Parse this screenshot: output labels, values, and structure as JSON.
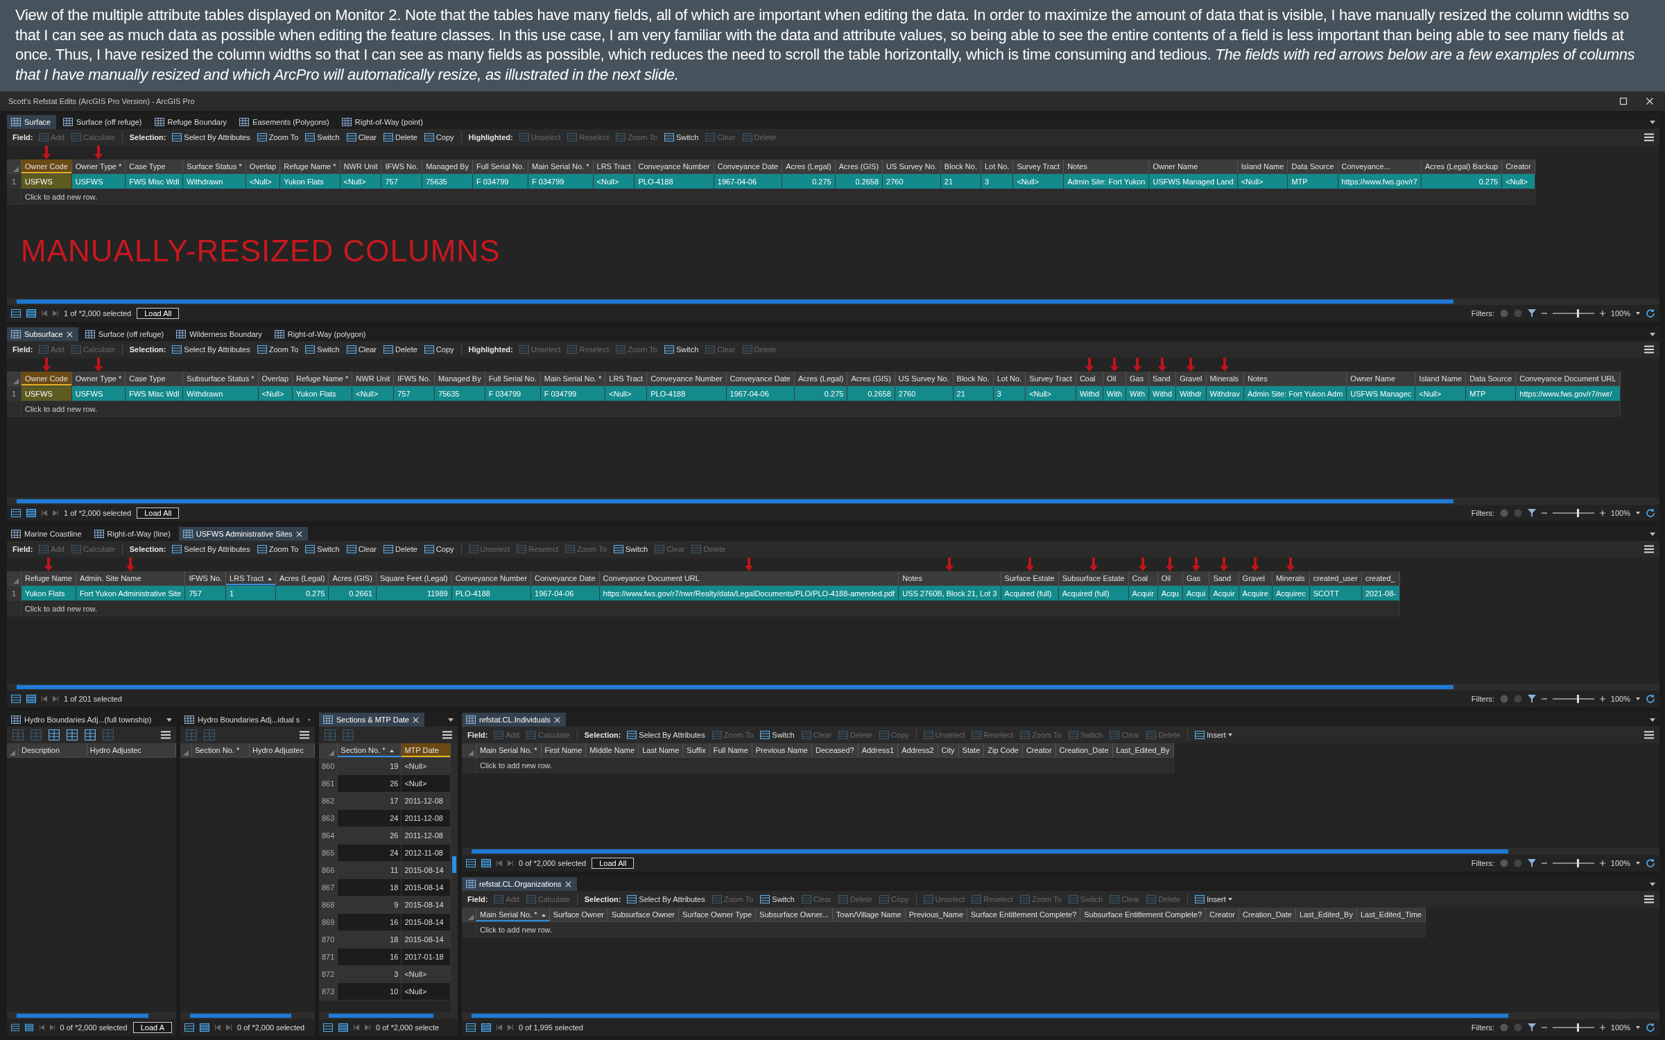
{
  "caption": "View of the multiple attribute tables displayed on Monitor 2. Note that the tables have many fields, all of which are important when editing the data. In order to maximize the amount of data that is visible, I have manually resized the column widths so that I can see as much data as possible when editing the feature classes. In this use case, I am very familiar with the data and attribute values, so being able to see the entire contents of a field is less important than being able to see many fields at once. Thus, I have resized the column widths so that I can see as many fields as possible, which reduces the need to scroll the table horizontally, which is time consuming and tedious. *The fields with red arrows below are a few examples of columns that I have manually resized and which ArcPro will automatically resize, as illustrated in the next slide.*",
  "window": {
    "title": "Scott's Refstat Edits (ArcGIS Pro Version) - ArcGIS Pro"
  },
  "panes": [
    {
      "tabs": [
        {
          "label": "Surface",
          "selected": true,
          "closable": false
        },
        {
          "label": "Surface (off refuge)",
          "selected": false,
          "closable": false
        },
        {
          "label": "Refuge Boundary",
          "selected": false,
          "closable": false
        },
        {
          "label": "Easements (Polygons)",
          "selected": false,
          "closable": false
        },
        {
          "label": "Right-of-Way (point)",
          "selected": false,
          "closable": false
        }
      ],
      "toolbar": {
        "kind": "full",
        "groups": [
          {
            "label": "Field:",
            "items": [
              {
                "label": "Add",
                "disabled": true
              },
              {
                "label": "Calculate",
                "disabled": true
              }
            ]
          },
          {
            "label": "Selection:",
            "items": [
              {
                "label": "Select By Attributes",
                "disabled": false
              },
              {
                "label": "Zoom To",
                "disabled": false
              },
              {
                "label": "Switch",
                "disabled": false
              },
              {
                "label": "Clear",
                "disabled": false
              },
              {
                "label": "Delete",
                "disabled": false
              },
              {
                "label": "Copy",
                "disabled": false
              }
            ]
          },
          {
            "label": "Highlighted:",
            "items": [
              {
                "label": "Unselect",
                "disabled": true
              },
              {
                "label": "Reselect",
                "disabled": true
              },
              {
                "label": "Zoom To",
                "disabled": true
              },
              {
                "label": "Switch",
                "disabled": false
              },
              {
                "label": "Clear",
                "disabled": true
              },
              {
                "label": "Delete",
                "disabled": true
              }
            ]
          }
        ]
      },
      "table": {
        "columns": [
          {
            "label": "Owner Code",
            "highlighted": true,
            "marked": true
          },
          {
            "label": "Owner Type *",
            "marked": true
          },
          {
            "label": "Case Type"
          },
          {
            "label": "Surface Status *"
          },
          {
            "label": "Overlap"
          },
          {
            "label": "Refuge Name *"
          },
          {
            "label": "NWR Unit"
          },
          {
            "label": "IFWS No."
          },
          {
            "label": "Managed By"
          },
          {
            "label": "Full Serial No."
          },
          {
            "label": "Main Serial No. *"
          },
          {
            "label": "LRS Tract"
          },
          {
            "label": "Conveyance Number"
          },
          {
            "label": "Conveyance Date"
          },
          {
            "label": "Acres (Legal)",
            "numeric": true
          },
          {
            "label": "Acres (GIS)",
            "numeric": true
          },
          {
            "label": "US Survey No."
          },
          {
            "label": "Block No."
          },
          {
            "label": "Lot No."
          },
          {
            "label": "Survey Tract"
          },
          {
            "label": "Notes"
          },
          {
            "label": "Owner Name"
          },
          {
            "label": "Island Name"
          },
          {
            "label": "Data Source"
          },
          {
            "label": "Conveyance..."
          },
          {
            "label": "Acres (Legal) Backup",
            "numeric": true
          },
          {
            "label": "Creator"
          }
        ],
        "rows": [
          {
            "number": "1",
            "selected": true,
            "cells": [
              "USFWS",
              "USFWS",
              "FWS Misc Wdl",
              "Withdrawn",
              "<Null>",
              "Yukon Flats",
              "<Null>",
              "757",
              "75635",
              "F 034799",
              "F 034799",
              "<Null>",
              "PLO-4188",
              "1967-04-06",
              "0.275",
              "0.2658",
              "2760",
              "21",
              "3",
              "<Null>",
              "Admin Site: Fort Yukon",
              "USFWS Managed Land",
              "<Null>",
              "MTP",
              "https://www.fws.gov/r7",
              "0.275",
              "<Null>"
            ]
          }
        ],
        "add_row": "Click to add new row."
      },
      "annotation": "MANUALLY-RESIZED COLUMNS",
      "footer": {
        "selection": "1 of *2,000 selected",
        "load_button": "Load All",
        "filters_label": "Filters:",
        "zoom": {
          "level": 0.62,
          "reading": "100%"
        }
      }
    },
    {
      "tabs": [
        {
          "label": "Subsurface",
          "selected": true,
          "closable": true
        },
        {
          "label": "Surface (off refuge)",
          "selected": false,
          "closable": false
        },
        {
          "label": "Wilderness Boundary",
          "selected": false,
          "closable": false
        },
        {
          "label": "Right-of-Way (polygon)",
          "selected": false,
          "closable": false
        }
      ],
      "toolbar": {
        "kind": "full",
        "groups": [
          {
            "label": "Field:",
            "items": [
              {
                "label": "Add",
                "disabled": true
              },
              {
                "label": "Calculate",
                "disabled": true
              }
            ]
          },
          {
            "label": "Selection:",
            "items": [
              {
                "label": "Select By Attributes",
                "disabled": false
              },
              {
                "label": "Zoom To",
                "disabled": false
              },
              {
                "label": "Switch",
                "disabled": false
              },
              {
                "label": "Clear",
                "disabled": false
              },
              {
                "label": "Delete",
                "disabled": false
              },
              {
                "label": "Copy",
                "disabled": false
              }
            ]
          },
          {
            "label": "Highlighted:",
            "items": [
              {
                "label": "Unselect",
                "disabled": true
              },
              {
                "label": "Reselect",
                "disabled": true
              },
              {
                "label": "Zoom To",
                "disabled": true
              },
              {
                "label": "Switch",
                "disabled": false
              },
              {
                "label": "Clear",
                "disabled": true
              },
              {
                "label": "Delete",
                "disabled": true
              }
            ]
          }
        ]
      },
      "table": {
        "columns": [
          {
            "label": "Owner Code",
            "highlighted": true,
            "marked": true
          },
          {
            "label": "Owner Type *",
            "marked": true
          },
          {
            "label": "Case Type"
          },
          {
            "label": "Subsurface Status *"
          },
          {
            "label": "Overlap"
          },
          {
            "label": "Refuge Name *"
          },
          {
            "label": "NWR Unit"
          },
          {
            "label": "IFWS No."
          },
          {
            "label": "Managed By"
          },
          {
            "label": "Full Serial No."
          },
          {
            "label": "Main Serial No. *"
          },
          {
            "label": "LRS Tract"
          },
          {
            "label": "Conveyance Number"
          },
          {
            "label": "Conveyance Date"
          },
          {
            "label": "Acres (Legal)",
            "numeric": true
          },
          {
            "label": "Acres (GIS)",
            "numeric": true
          },
          {
            "label": "US Survey No."
          },
          {
            "label": "Block No."
          },
          {
            "label": "Lot No."
          },
          {
            "label": "Survey Tract"
          },
          {
            "label": "Coal",
            "marked": true
          },
          {
            "label": "Oil",
            "marked": true
          },
          {
            "label": "Gas",
            "marked": true
          },
          {
            "label": "Sand",
            "marked": true
          },
          {
            "label": "Gravel",
            "marked": true
          },
          {
            "label": "Minerals",
            "marked": true
          },
          {
            "label": "Notes"
          },
          {
            "label": "Owner Name"
          },
          {
            "label": "Island Name"
          },
          {
            "label": "Data Source"
          },
          {
            "label": "Conveyance Document URL"
          }
        ],
        "rows": [
          {
            "number": "1",
            "selected": true,
            "cells": [
              "USFWS",
              "USFWS",
              "FWS Misc Wdl",
              "Withdrawn",
              "<Null>",
              "Yukon Flats",
              "<Null>",
              "757",
              "75635",
              "F 034799",
              "F 034799",
              "<Null>",
              "PLO-4188",
              "1967-04-06",
              "0.275",
              "0.2658",
              "2760",
              "21",
              "3",
              "<Null>",
              "Withd",
              "With",
              "With",
              "Withd",
              "Withdr",
              "Withdrav",
              "Admin Site: Fort Yukon Adm",
              "USFWS Managec",
              "<Null>",
              "MTP",
              "https://www.fws.gov/r7/nwr/"
            ]
          }
        ],
        "add_row": "Click to add new row."
      },
      "footer": {
        "selection": "1 of *2,000 selected",
        "load_button": "Load All",
        "filters_label": "Filters:",
        "zoom": {
          "level": 0.62,
          "reading": "100%"
        }
      }
    },
    {
      "tabs": [
        {
          "label": "Marine Coastline",
          "selected": false,
          "closable": false
        },
        {
          "label": "Right-of-Way (line)",
          "selected": false,
          "closable": false
        },
        {
          "label": "USFWS Administrative Sites",
          "selected": true,
          "closable": true
        }
      ],
      "toolbar": {
        "kind": "full",
        "groups": [
          {
            "label": "Field:",
            "items": [
              {
                "label": "Add",
                "disabled": true
              },
              {
                "label": "Calculate",
                "disabled": true
              }
            ]
          },
          {
            "label": "Selection:",
            "items": [
              {
                "label": "Select By Attributes",
                "disabled": false
              },
              {
                "label": "Zoom To",
                "disabled": false
              },
              {
                "label": "Switch",
                "disabled": false
              },
              {
                "label": "Clear",
                "disabled": false
              },
              {
                "label": "Delete",
                "disabled": false
              },
              {
                "label": "Copy",
                "disabled": false
              }
            ]
          },
          {
            "items": [
              {
                "label": "Unselect",
                "disabled": true
              },
              {
                "label": "Reselect",
                "disabled": true
              },
              {
                "label": "Zoom To",
                "disabled": true
              },
              {
                "label": "Switch",
                "disabled": false
              },
              {
                "label": "Clear",
                "disabled": true
              },
              {
                "label": "Delete",
                "disabled": true
              }
            ]
          }
        ]
      },
      "table": {
        "columns": [
          {
            "label": "Refuge Name",
            "marked": true
          },
          {
            "label": "Admin. Site Name",
            "marked": true
          },
          {
            "label": "IFWS No."
          },
          {
            "label": "LRS Tract",
            "sorted": true
          },
          {
            "label": "Acres (Legal)",
            "numeric": true
          },
          {
            "label": "Acres (GIS)",
            "numeric": true
          },
          {
            "label": "Square Feet (Legal)",
            "numeric": true
          },
          {
            "label": "Conveyance Number"
          },
          {
            "label": "Conveyance Date"
          },
          {
            "label": "Conveyance Document URL",
            "marked": true
          },
          {
            "label": "Notes",
            "marked": true
          },
          {
            "label": "Surface Estate",
            "marked": true
          },
          {
            "label": "Subsurface Estate",
            "marked": true
          },
          {
            "label": "Coal",
            "marked": true
          },
          {
            "label": "Oil",
            "marked": true
          },
          {
            "label": "Gas",
            "marked": true
          },
          {
            "label": "Sand",
            "marked": true
          },
          {
            "label": "Gravel",
            "marked": true
          },
          {
            "label": "Minerals",
            "marked": true
          },
          {
            "label": "created_user"
          },
          {
            "label": "created_"
          }
        ],
        "rows": [
          {
            "number": "1",
            "selected": true,
            "cells": [
              "Yukon Flats",
              "Fort Yukon Administrative Site",
              "757",
              "1",
              "0.275",
              "0.2661",
              "11989",
              "PLO-4188",
              "1967-04-06",
              "https://www.fws.gov/r7/nwr/Realty/data/LegalDocuments/PLO/PLO-4188-amended.pdf",
              "USS 2760B, Block 21, Lot 3",
              "Acquired (full)",
              "Acquired (full)",
              "Acquir",
              "Acqu",
              "Acqui",
              "Acquir",
              "Acquire",
              "Acquirec",
              "SCOTT",
              "2021-08-"
            ]
          }
        ],
        "add_row": "Click to add new row."
      },
      "footer": {
        "selection": "1 of 201 selected",
        "filters_label": "Filters:",
        "zoom": {
          "level": 0.62,
          "reading": "100%"
        }
      }
    },
    {
      "tabs": [
        {
          "label": "Hydro Boundaries Adj...(full township)",
          "selected": false,
          "closable": false
        }
      ],
      "toolbar": {
        "kind": "compact",
        "items": [
          {
            "disabled": true
          },
          {
            "disabled": true
          },
          {
            "disabled": false
          },
          {
            "disabled": false
          },
          {
            "disabled": false
          },
          {
            "disabled": true
          }
        ]
      },
      "table": {
        "columns": [
          {
            "label": "Description"
          },
          {
            "label": "Hydro Adjustec"
          }
        ]
      },
      "footer": {
        "selection": "0 of *2,000 selected",
        "load_button": "Load A"
      }
    },
    {
      "tabs": [
        {
          "label": "Hydro Boundaries Adj...idual s",
          "selected": false,
          "closable": false
        }
      ],
      "toolbar": {
        "kind": "compact",
        "items": [
          {
            "disabled": true
          },
          {
            "disabled": true
          }
        ]
      },
      "table": {
        "columns": [
          {
            "label": "Section No. *"
          },
          {
            "label": "Hydro Adjustec"
          }
        ]
      },
      "footer": {
        "selection": "0 of *2,000 selected"
      }
    },
    {
      "tabs": [
        {
          "label": "Sections & MTP Date",
          "selected": true,
          "closable": true
        }
      ],
      "toolbar": {
        "kind": "compact",
        "items": [
          {
            "disabled": true
          },
          {
            "disabled": true
          }
        ]
      },
      "table": {
        "columns": [
          {
            "label": "Section No. *",
            "numeric": true,
            "sorted": true
          },
          {
            "label": "MTP Date",
            "highlighted": true
          }
        ],
        "rows": [
          {
            "number": "860",
            "selected": false,
            "cells": [
              "19",
              "<Null>"
            ]
          },
          {
            "number": "861",
            "selected": false,
            "cells": [
              "26",
              "<Null>"
            ]
          },
          {
            "number": "862",
            "selected": false,
            "cells": [
              "17",
              "2011-12-08"
            ]
          },
          {
            "number": "863",
            "selected": false,
            "cells": [
              "24",
              "2011-12-08"
            ]
          },
          {
            "number": "864",
            "selected": false,
            "cells": [
              "26",
              "2011-12-08"
            ]
          },
          {
            "number": "865",
            "selected": false,
            "cells": [
              "24",
              "2012-11-08"
            ]
          },
          {
            "number": "866",
            "selected": false,
            "cells": [
              "11",
              "2015-08-14"
            ]
          },
          {
            "number": "867",
            "selected": false,
            "cells": [
              "18",
              "2015-08-14"
            ]
          },
          {
            "number": "868",
            "selected": false,
            "cells": [
              "9",
              "2015-08-14"
            ]
          },
          {
            "number": "869",
            "selected": false,
            "cells": [
              "16",
              "2015-08-14"
            ]
          },
          {
            "number": "870",
            "selected": false,
            "cells": [
              "18",
              "2015-08-14"
            ]
          },
          {
            "number": "871",
            "selected": false,
            "cells": [
              "16",
              "2017-01-18"
            ]
          },
          {
            "number": "872",
            "selected": false,
            "cells": [
              "3",
              "<Null>"
            ]
          },
          {
            "number": "873",
            "selected": false,
            "cells": [
              "10",
              "<Null>"
            ]
          }
        ]
      },
      "footer": {
        "selection": "0 of *2,000 selecte"
      }
    },
    {
      "tabs": [
        {
          "label": "refstat.CL.Individuals",
          "selected": true,
          "closable": true
        }
      ],
      "toolbar": {
        "kind": "full",
        "groups": [
          {
            "label": "Field:",
            "items": [
              {
                "label": "Add",
                "disabled": true
              },
              {
                "label": "Calculate",
                "disabled": true
              }
            ]
          },
          {
            "label": "Selection:",
            "items": [
              {
                "label": "Select By Attributes",
                "disabled": false
              },
              {
                "label": "Zoom To",
                "disabled": true
              },
              {
                "label": "Switch",
                "disabled": false
              },
              {
                "label": "Clear",
                "disabled": true
              },
              {
                "label": "Delete",
                "disabled": true
              },
              {
                "label": "Copy",
                "disabled": true
              }
            ]
          },
          {
            "items": [
              {
                "label": "Unselect",
                "disabled": true
              },
              {
                "label": "Reselect",
                "disabled": true
              },
              {
                "label": "Zoom To",
                "disabled": true
              },
              {
                "label": "Switch",
                "disabled": true
              },
              {
                "label": "Clear",
                "disabled": true
              },
              {
                "label": "Delete",
                "disabled": true
              }
            ]
          },
          {
            "items": [
              {
                "label": "Insert",
                "disabled": false,
                "dropdown": true
              }
            ]
          }
        ]
      },
      "table": {
        "columns": [
          {
            "label": "Main Serial No. *"
          },
          {
            "label": "First Name"
          },
          {
            "label": "Middle Name"
          },
          {
            "label": "Last Name"
          },
          {
            "label": "Suffix"
          },
          {
            "label": "Full Name"
          },
          {
            "label": "Previous Name"
          },
          {
            "label": "Deceased?"
          },
          {
            "label": "Address1"
          },
          {
            "label": "Address2"
          },
          {
            "label": "City"
          },
          {
            "label": "State"
          },
          {
            "label": "Zip Code"
          },
          {
            "label": "Creator"
          },
          {
            "label": "Creation_Date"
          },
          {
            "label": "Last_Edited_By"
          }
        ],
        "add_row": "Click to add new row."
      },
      "footer": {
        "selection": "0 of *2,000 selected",
        "load_button": "Load All",
        "filters_label": "Filters:",
        "zoom": {
          "level": 0.62,
          "reading": "100%"
        }
      }
    },
    {
      "tabs": [
        {
          "label": "refstat.CL.Organizations",
          "selected": true,
          "closable": true
        }
      ],
      "toolbar": {
        "kind": "full",
        "groups": [
          {
            "label": "Field:",
            "items": [
              {
                "label": "Add",
                "disabled": true
              },
              {
                "label": "Calculate",
                "disabled": true
              }
            ]
          },
          {
            "label": "Selection:",
            "items": [
              {
                "label": "Select By Attributes",
                "disabled": false
              },
              {
                "label": "Zoom To",
                "disabled": true
              },
              {
                "label": "Switch",
                "disabled": false
              },
              {
                "label": "Clear",
                "disabled": true
              },
              {
                "label": "Delete",
                "disabled": true
              },
              {
                "label": "Copy",
                "disabled": true
              }
            ]
          },
          {
            "items": [
              {
                "label": "Unselect",
                "disabled": true
              },
              {
                "label": "Reselect",
                "disabled": true
              },
              {
                "label": "Zoom To",
                "disabled": true
              },
              {
                "label": "Switch",
                "disabled": true
              },
              {
                "label": "Clear",
                "disabled": true
              },
              {
                "label": "Delete",
                "disabled": true
              }
            ]
          },
          {
            "items": [
              {
                "label": "Insert",
                "disabled": false,
                "dropdown": true
              }
            ]
          }
        ]
      },
      "table": {
        "columns": [
          {
            "label": "Main Serial No. *",
            "sorted": true
          },
          {
            "label": "Surface Owner"
          },
          {
            "label": "Subsurface Owner"
          },
          {
            "label": "Surface Owner Type"
          },
          {
            "label": "Subsurface Owner..."
          },
          {
            "label": "Town/Village Name"
          },
          {
            "label": "Previous_Name"
          },
          {
            "label": "Surface Entitlement Complete?"
          },
          {
            "label": "Subsurface Entitlement Complete?"
          },
          {
            "label": "Creator"
          },
          {
            "label": "Creation_Date"
          },
          {
            "label": "Last_Edited_By"
          },
          {
            "label": "Last_Edited_Time"
          }
        ],
        "add_row": "Click to add new row."
      },
      "footer": {
        "selection": "0 of 1,995 selected",
        "filters_label": "Filters:",
        "zoom": {
          "level": 0.62,
          "reading": "100%"
        }
      }
    }
  ]
}
